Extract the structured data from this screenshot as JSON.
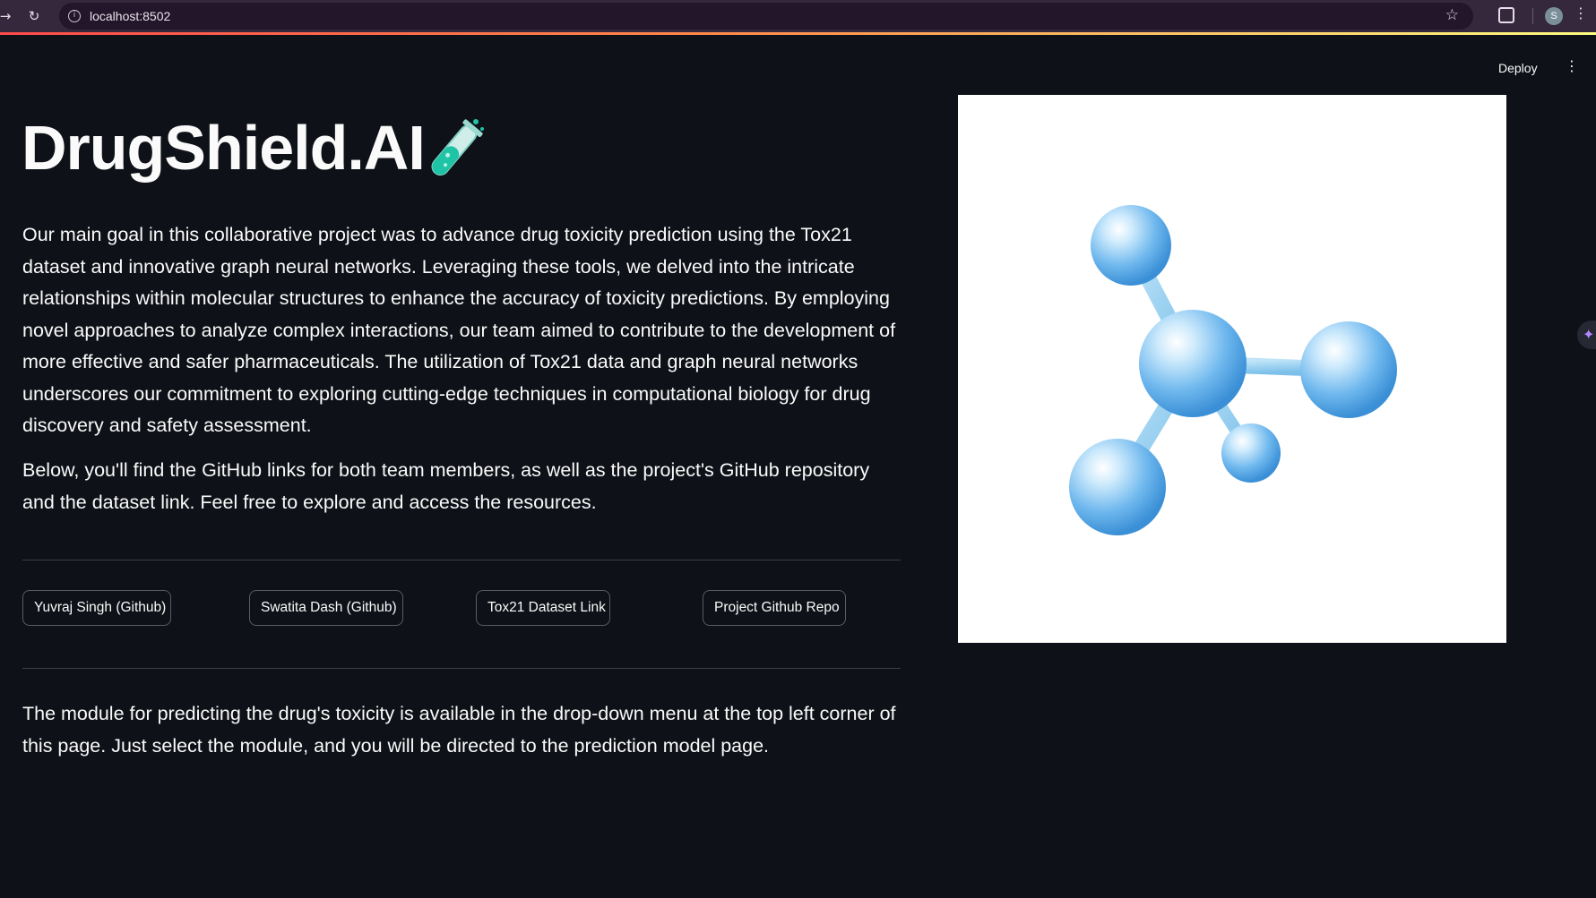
{
  "browser": {
    "url": "localhost:8502",
    "profile_initial": "S"
  },
  "header": {
    "deploy_label": "Deploy"
  },
  "main": {
    "title": "DrugShield.AI",
    "intro": "Our main goal in this collaborative project was to advance drug toxicity prediction using the Tox21 dataset and innovative graph neural networks. Leveraging these tools, we delved into the intricate relationships within molecular structures to enhance the accuracy of toxicity predictions. By employing novel approaches to analyze complex interactions, our team aimed to contribute to the development of more effective and safer pharmaceuticals. The utilization of Tox21 data and graph neural networks underscores our commitment to exploring cutting-edge techniques in computational biology for drug discovery and safety assessment.",
    "links_intro": "Below, you'll find the GitHub links for both team members, as well as the project's GitHub repository and the dataset link. Feel free to explore and access the resources.",
    "buttons": [
      {
        "label": "Yuvraj Singh (Github)"
      },
      {
        "label": "Swatita Dash (Github)"
      },
      {
        "label": "Tox21 Dataset Link"
      },
      {
        "label": "Project Github Repo"
      }
    ],
    "footer_note": "The module for predicting the drug's toxicity is available in the drop-down menu at the top left corner of this page. Just select the module, and you will be directed to the prediction model page."
  },
  "colors": {
    "background": "#0e1117",
    "text": "#fafafa",
    "accent": "#ff4b4b",
    "molecule": "#6fb8ee"
  }
}
